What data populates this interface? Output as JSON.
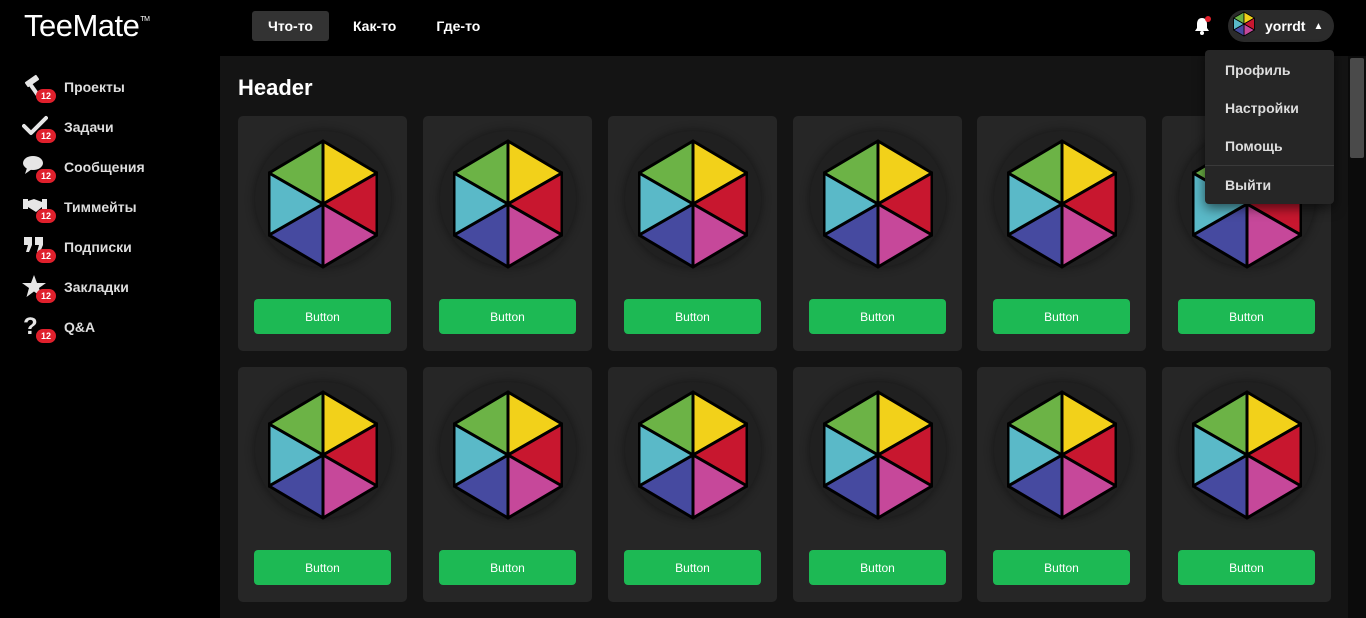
{
  "app": {
    "logo": "TeeMate",
    "logo_tm": "TM"
  },
  "nav": {
    "tabs": [
      {
        "label": "Что-то",
        "active": true
      },
      {
        "label": "Как-то"
      },
      {
        "label": "Где-то"
      }
    ]
  },
  "user": {
    "name": "yorrdt",
    "has_notification": true
  },
  "sidebar": {
    "items": [
      {
        "label": "Проекты",
        "badge": "12",
        "icon": "hammer-icon"
      },
      {
        "label": "Задачи",
        "badge": "12",
        "icon": "checkmark-icon"
      },
      {
        "label": "Сообщения",
        "badge": "12",
        "icon": "chat-icon"
      },
      {
        "label": "Тиммейты",
        "badge": "12",
        "icon": "handshake-icon"
      },
      {
        "label": "Подписки",
        "badge": "12",
        "icon": "quote-icon"
      },
      {
        "label": "Закладки",
        "badge": "12",
        "icon": "star-icon"
      },
      {
        "label": "Q&A",
        "badge": "12",
        "icon": "question-icon"
      }
    ]
  },
  "main": {
    "title": "Header",
    "cards": [
      {
        "button": "Button"
      },
      {
        "button": "Button"
      },
      {
        "button": "Button"
      },
      {
        "button": "Button"
      },
      {
        "button": "Button"
      },
      {
        "button": "Button"
      },
      {
        "button": "Button"
      },
      {
        "button": "Button"
      },
      {
        "button": "Button"
      },
      {
        "button": "Button"
      },
      {
        "button": "Button"
      },
      {
        "button": "Button"
      }
    ]
  },
  "dropdown": {
    "items": [
      {
        "label": "Профиль"
      },
      {
        "label": "Настройки"
      },
      {
        "label": "Помощь"
      },
      {
        "label": "Выйти"
      }
    ]
  },
  "colors": {
    "accent_green": "#1db954",
    "badge_red": "#e0202c",
    "hex_green": "#6cb346",
    "hex_yellow": "#f2d11a",
    "hex_red": "#c8172f",
    "hex_pink": "#c6489a",
    "hex_blue": "#464aa0",
    "hex_cyan": "#5ab9c8"
  }
}
